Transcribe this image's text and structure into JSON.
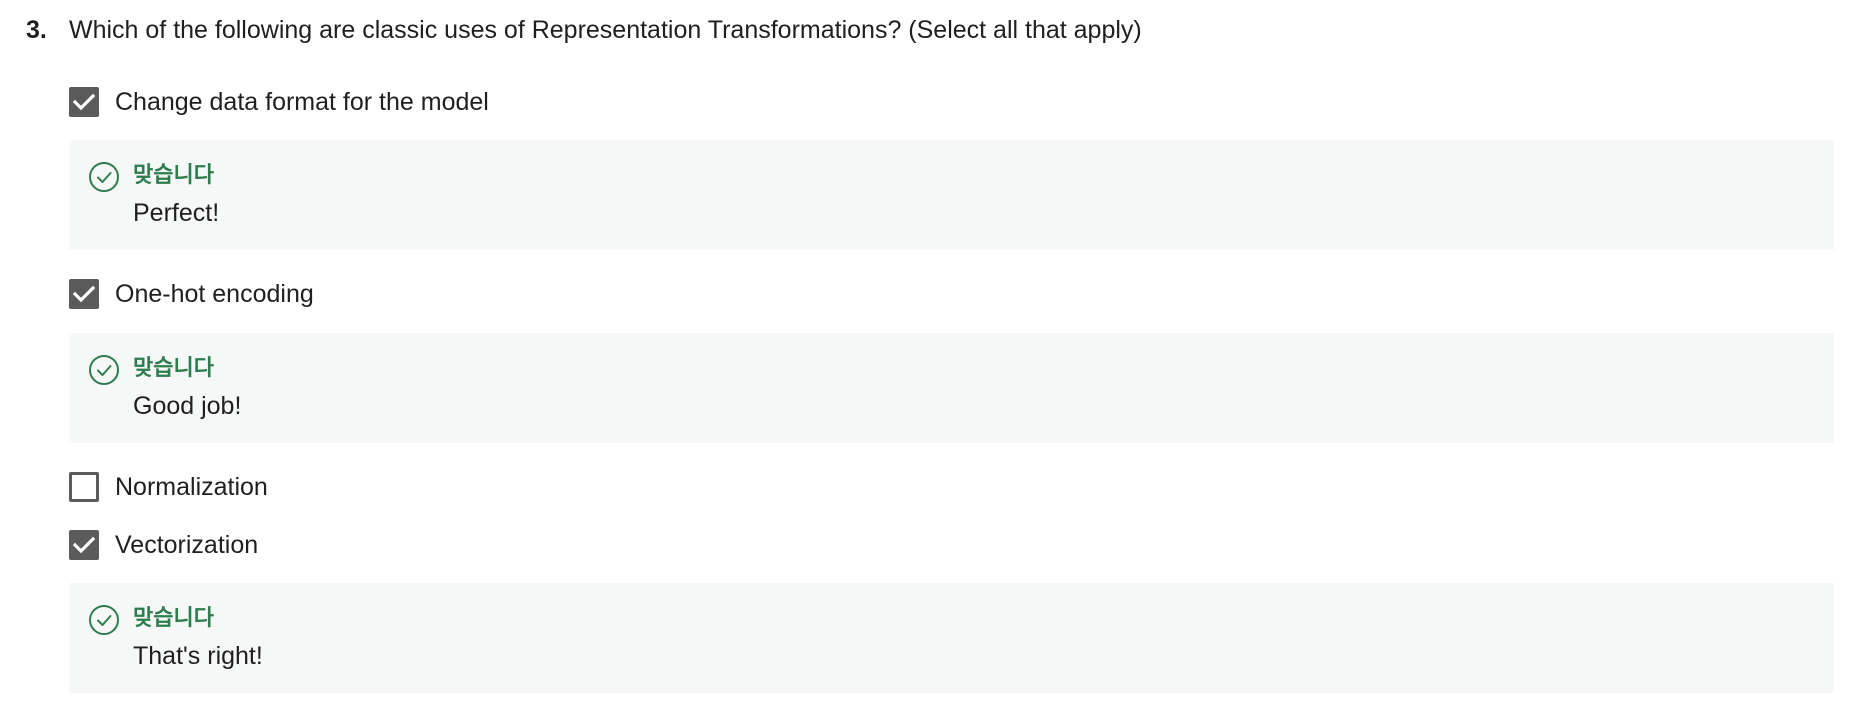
{
  "question": {
    "number": "3.",
    "text": "Which of the following are classic uses of Representation Transformations? (Select all that apply)"
  },
  "options": [
    {
      "label": "Change data format for the model",
      "checked": true,
      "feedback": {
        "status": "맞습니다",
        "message": "Perfect!"
      }
    },
    {
      "label": "One-hot encoding",
      "checked": true,
      "feedback": {
        "status": "맞습니다",
        "message": "Good job!"
      }
    },
    {
      "label": "Normalization",
      "checked": false
    },
    {
      "label": "Vectorization",
      "checked": true,
      "feedback": {
        "status": "맞습니다",
        "message": "That's right!"
      }
    }
  ],
  "colors": {
    "checkbox": "#5b5b5b",
    "correct": "#2e7d4f",
    "feedback_bg": "#f6f8f7"
  },
  "icons": {
    "checked": "checkmark-icon",
    "feedback": "check-circle-icon"
  }
}
